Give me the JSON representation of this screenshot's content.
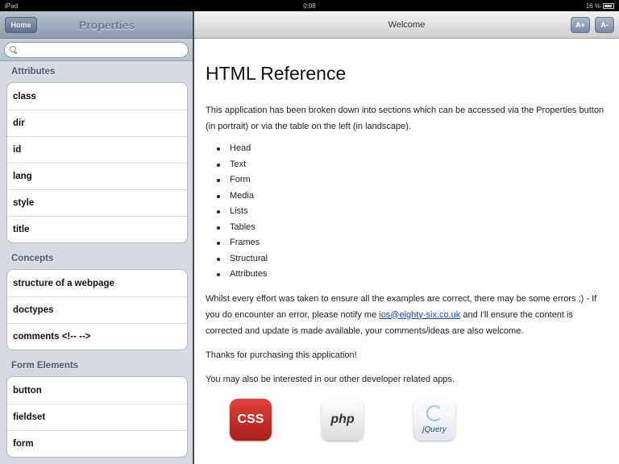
{
  "status_bar": {
    "carrier": "iPad",
    "time": "0:08",
    "battery": "16 %"
  },
  "left_pane": {
    "home_button": "Home",
    "title": "Properties",
    "search": {
      "value": "",
      "placeholder": ""
    },
    "sections": [
      {
        "header": "Attributes",
        "items": [
          "class",
          "dir",
          "id",
          "lang",
          "style",
          "title"
        ]
      },
      {
        "header": "Concepts",
        "items": [
          "structure of a webpage",
          "doctypes",
          "comments <!-- -->"
        ]
      },
      {
        "header": "Form Elements",
        "items": [
          "button",
          "fieldset",
          "form"
        ]
      }
    ]
  },
  "right_pane": {
    "title": "Welcome",
    "btn_1": "A+",
    "btn_2": "A-",
    "heading": "HTML Reference",
    "intro": "This application has been broken down into sections which can be accessed via the Properties button (in portrait) or via the table on the left (in landscape).",
    "topics": [
      "Head",
      "Text",
      "Form",
      "Media",
      "Lists",
      "Tables",
      "Frames",
      "Structural",
      "Attributes"
    ],
    "para_errors_before": "Whilst every effort was taken to ensure all the examples are correct, there may be some errors ;) - If you do encounter an error, please notify me ",
    "email": "ios@eighty-six.co.uk",
    "para_errors_after": " and I'll ensure the content is corrected and update is made available, your comments/ideas are also welcome.",
    "thanks": "Thanks for purchasing this application!",
    "other_apps": "You may also be interested in our other developer related apps.",
    "apps": [
      {
        "label": "CSS",
        "icon": "css-app-icon"
      },
      {
        "label": "php",
        "icon": "php-app-icon"
      },
      {
        "label": "jQuery",
        "icon": "jquery-app-icon"
      }
    ]
  }
}
